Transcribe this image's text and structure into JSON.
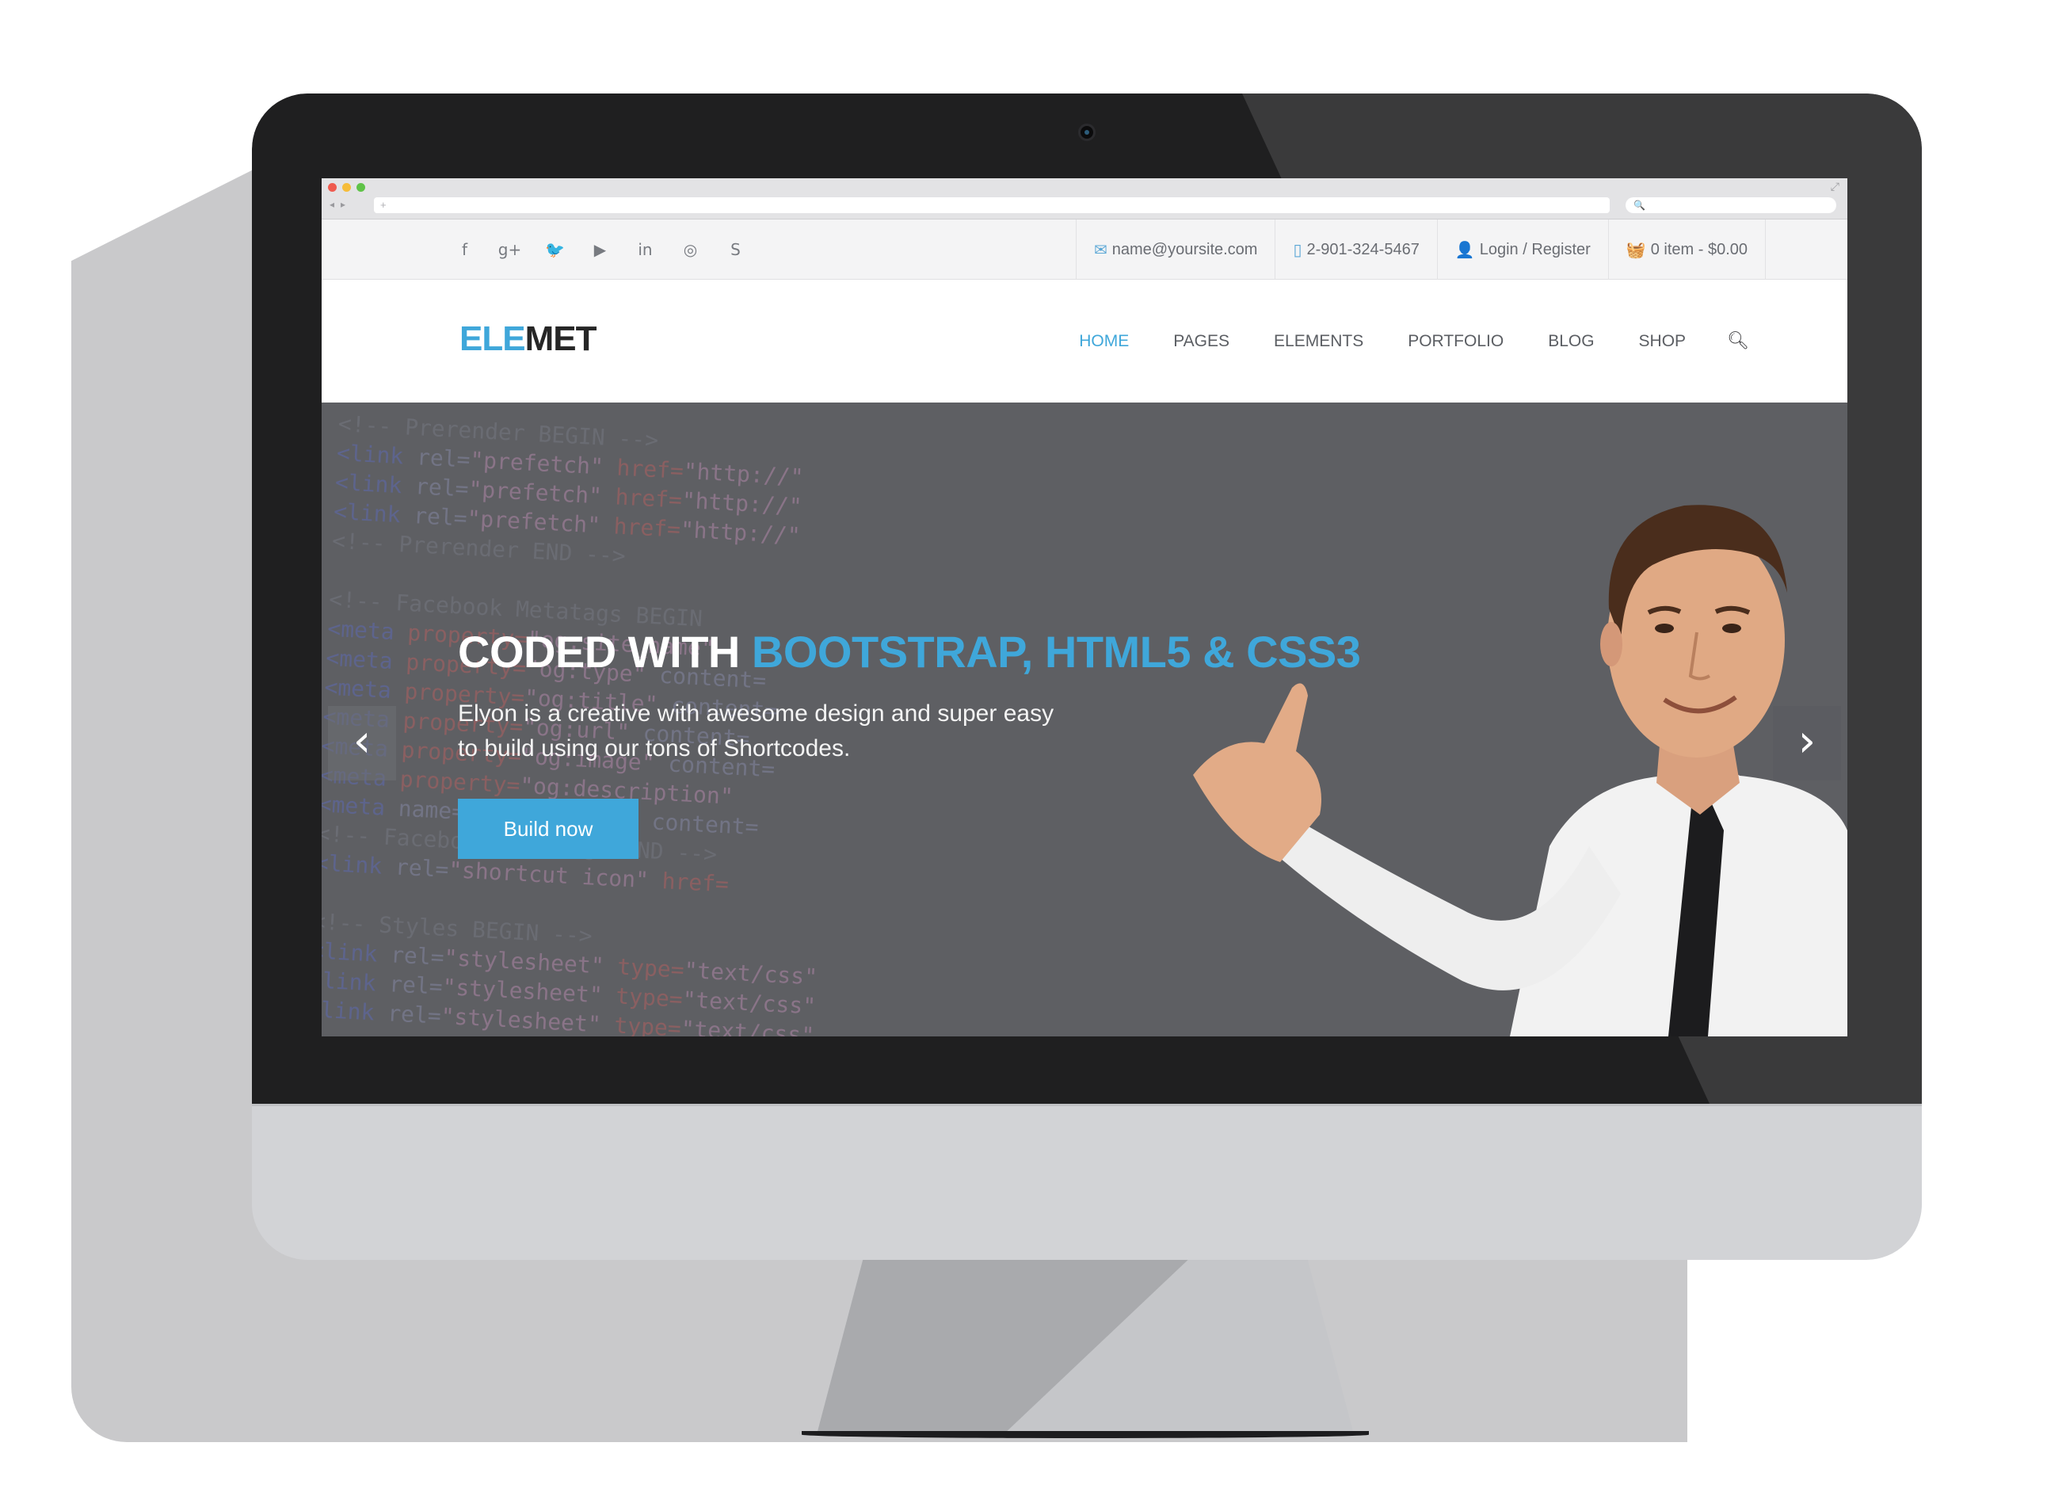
{
  "browser": {
    "url_placeholder": "+",
    "search_placeholder": "🔍"
  },
  "topbar": {
    "social_icons": [
      "facebook-icon",
      "google-plus-icon",
      "twitter-icon",
      "youtube-icon",
      "linkedin-icon",
      "dribbble-icon",
      "skype-icon"
    ],
    "social_glyphs": [
      "f",
      "g+",
      "🐦",
      "▶",
      "in",
      "◎",
      "S"
    ],
    "email": "name@yoursite.com",
    "phone": "2-901-324-5467",
    "login": "Login / Register",
    "cart": "0 item - $0.00"
  },
  "header": {
    "logo_part1": "ELE",
    "logo_part2": "MET",
    "menu": [
      "HOME",
      "PAGES",
      "ELEMENTS",
      "PORTFOLIO",
      "BLOG",
      "SHOP"
    ],
    "active_menu": "HOME"
  },
  "hero": {
    "title_part1": "CODED WITH",
    "title_highlight": "BOOTSTRAP, HTML5 & CSS3",
    "subtitle": "Elyon is a creative with awesome design and super easy to build using our tons of Shortcodes.",
    "button": "Build now",
    "prev_arrow": "‹",
    "next_arrow": "›"
  },
  "colors": {
    "accent": "#3fa7da",
    "dark": "#262626",
    "hero_overlay": "#5e5f63"
  }
}
